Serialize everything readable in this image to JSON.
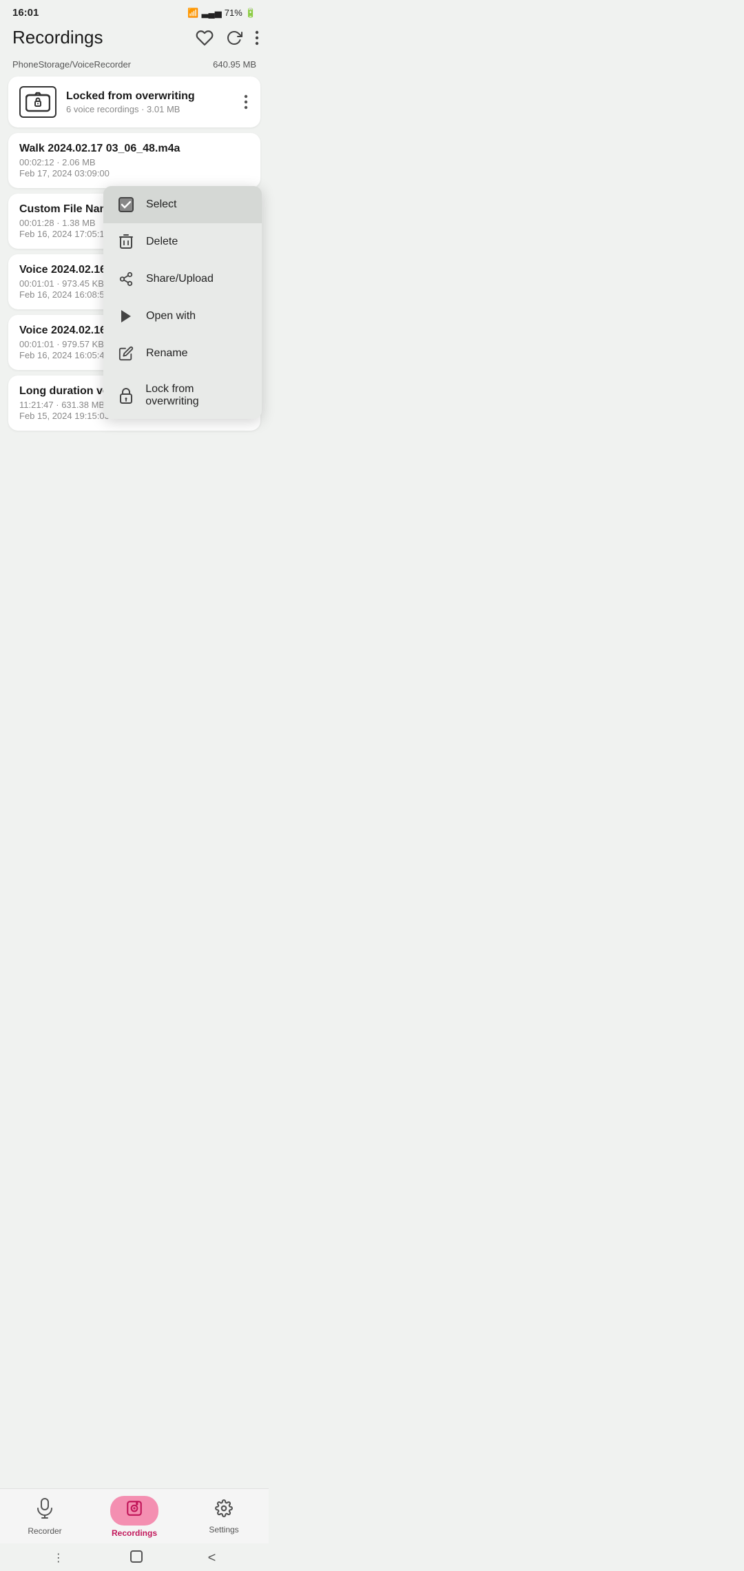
{
  "statusBar": {
    "time": "16:01",
    "battery": "71%",
    "batteryIcon": "🔋"
  },
  "appBar": {
    "title": "Recordings",
    "heartIcon": "🤝",
    "refreshIcon": "↺",
    "moreIcon": "⋮"
  },
  "storage": {
    "path": "PhoneStorage/VoiceRecorder",
    "size": "640.95 MB"
  },
  "lockedFolder": {
    "title": "Locked from overwriting",
    "meta": "6 voice recordings · 3.01 MB"
  },
  "recordings": [
    {
      "title": "Walk 2024.02.17 03_06_48.m4a",
      "duration": "00:02:12",
      "size": "2.06 MB",
      "date": "Feb 17, 2024 03:09:00"
    },
    {
      "title": "Custom File Name…",
      "duration": "00:01:28",
      "size": "1.38 MB",
      "date": "Feb 16, 2024 17:05:12"
    },
    {
      "title": "Voice 2024.02.16…",
      "duration": "00:01:01",
      "size": "973.45 KB",
      "date": "Feb 16, 2024 16:08:51"
    },
    {
      "title": "Voice 2024.02.16…",
      "duration": "00:01:01",
      "size": "979.57 KB",
      "date": "Feb 16, 2024 16:05:49"
    },
    {
      "title": "Long duration voice recording.m4a",
      "duration": "11:21:47",
      "size": "631.38 MB",
      "date": "Feb 15, 2024 19:15:03"
    }
  ],
  "contextMenu": {
    "items": [
      {
        "label": "Select",
        "icon": "☑"
      },
      {
        "label": "Delete",
        "icon": "🗑"
      },
      {
        "label": "Share/Upload",
        "icon": "⤴"
      },
      {
        "label": "Open with",
        "icon": "▶"
      },
      {
        "label": "Rename",
        "icon": "✏"
      },
      {
        "label": "Lock from overwriting",
        "icon": "🔒"
      }
    ]
  },
  "bottomNav": {
    "items": [
      {
        "label": "Recorder",
        "icon": "🎤",
        "active": false
      },
      {
        "label": "Recordings",
        "icon": "🎵",
        "active": true
      },
      {
        "label": "Settings",
        "icon": "⚙",
        "active": false
      }
    ]
  },
  "sysNav": {
    "back": "‹",
    "home": "□",
    "recents": "|||"
  }
}
